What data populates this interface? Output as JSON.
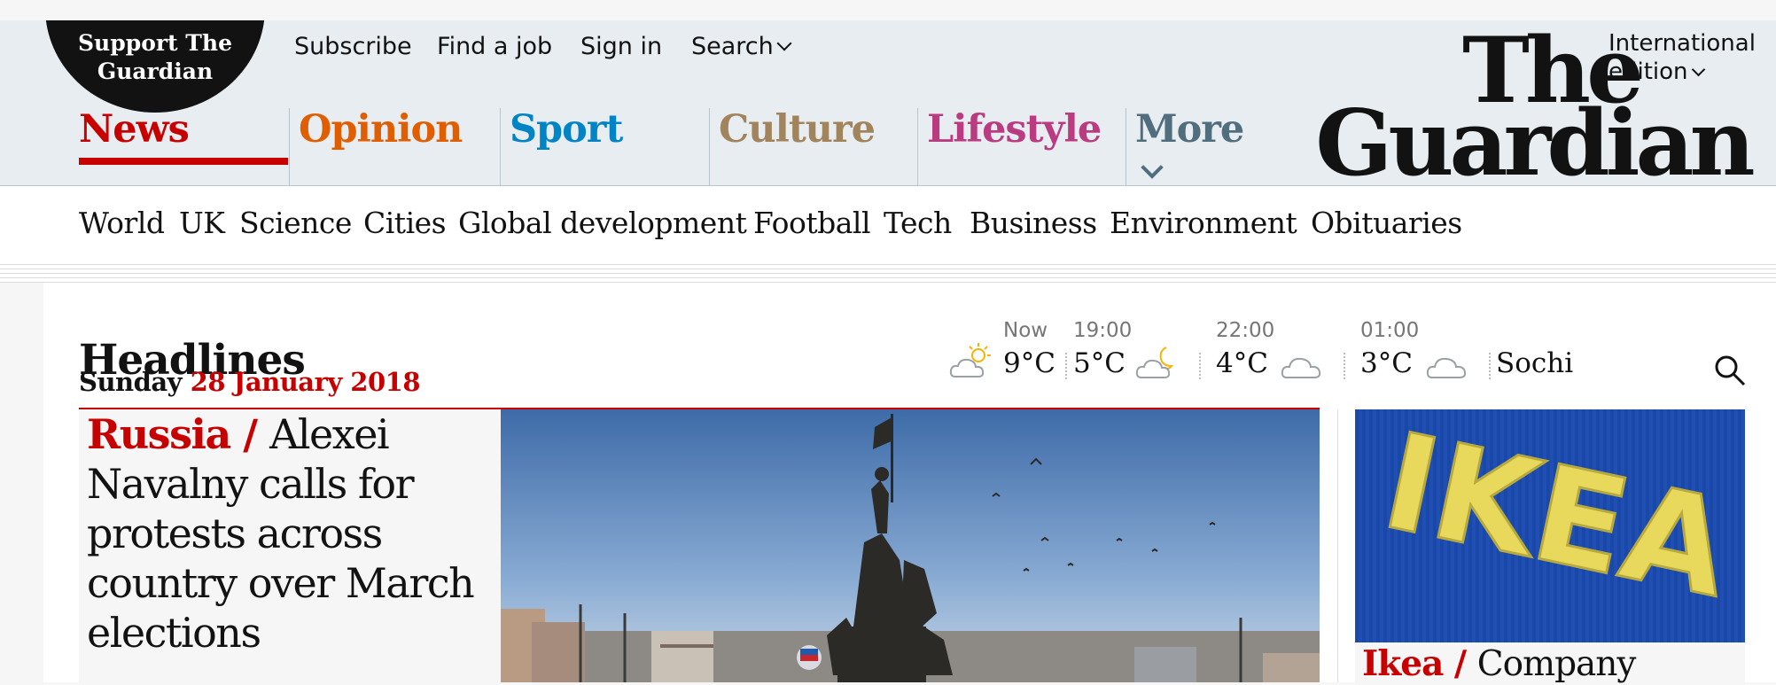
{
  "header": {
    "support_line1": "Support The",
    "support_line2": "Guardian",
    "links": {
      "subscribe": "Subscribe",
      "find_job": "Find a job",
      "sign_in": "Sign in",
      "search": "Search"
    },
    "edition_line1": "International",
    "edition_line2": "edition",
    "logo_line1": "The",
    "logo_line2": "Guardian"
  },
  "pillars": [
    {
      "label": "News",
      "color": "#c70000"
    },
    {
      "label": "Opinion",
      "color": "#e05e00"
    },
    {
      "label": "Sport",
      "color": "#0084c6"
    },
    {
      "label": "Culture",
      "color": "#a1845c"
    },
    {
      "label": "Lifestyle",
      "color": "#bb3b80"
    },
    {
      "label": "More",
      "color": "#506e7e"
    }
  ],
  "subnav": [
    "World",
    "UK",
    "Science",
    "Cities",
    "Global development",
    "Football",
    "Tech",
    "Business",
    "Environment",
    "Obituaries"
  ],
  "section": {
    "title": "Headlines",
    "day": "Sunday",
    "date": "28 January 2018"
  },
  "weather": {
    "now_label": "Now",
    "now_temp": "9°C",
    "forecast": [
      {
        "time": "19:00",
        "temp": "5°C",
        "icon": "partly-cloudy-night-icon"
      },
      {
        "time": "22:00",
        "temp": "4°C",
        "icon": "cloud-icon"
      },
      {
        "time": "01:00",
        "temp": "3°C",
        "icon": "cloud-icon"
      }
    ],
    "now_icon": "partly-sunny-icon",
    "location": "Sochi"
  },
  "main_story": {
    "kicker": "Russia",
    "slash": " / ",
    "headline": "Alexei Navalny calls for protests across country over March elections"
  },
  "side_story": {
    "kicker": "Ikea",
    "slash": " / ",
    "headline": "Company",
    "image_text": "IKEA"
  },
  "colors": {
    "accent_red": "#c70000",
    "header_bg": "#e7edf0",
    "brand_dark": "#121212"
  }
}
